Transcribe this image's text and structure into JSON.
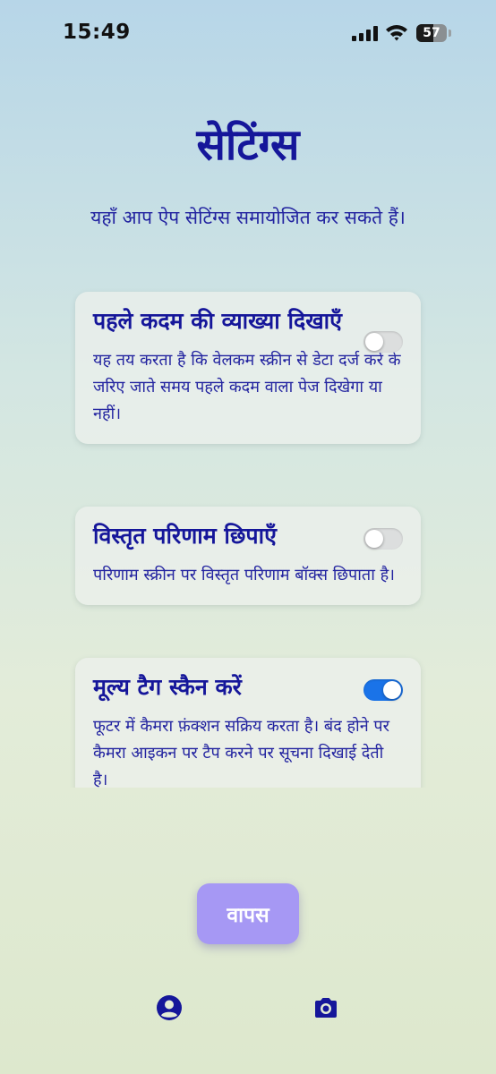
{
  "status_bar": {
    "time": "15:49",
    "battery_percent": 57,
    "battery_label": "57",
    "icons": [
      "cellular-signal-icon",
      "wifi-icon",
      "battery-icon"
    ]
  },
  "header": {
    "title": "सेटिंग्स",
    "subtitle": "यहाँ आप ऐप सेटिंग्स समायोजित कर सकते हैं।"
  },
  "settings": [
    {
      "title": "पहले कदम की व्याख्या दिखाएँ",
      "description": "यह तय करता है कि वेलकम स्क्रीन से डेटा दर्ज करें के जरिए जाते समय पहले कदम वाला पेज दिखेगा या नहीं।",
      "enabled": false
    },
    {
      "title": "विस्तृत परिणाम छिपाएँ",
      "description": "परिणाम स्क्रीन पर विस्तृत परिणाम बॉक्स छिपाता है।",
      "enabled": false
    },
    {
      "title": "मूल्य टैग स्कैन करें",
      "description": "फूटर में कैमरा फ़ंक्शन सक्रिय करता है। बंद होने पर कैमरा आइकन पर टैप करने पर सूचना दिखाई देती है।",
      "enabled": true
    }
  ],
  "actions": {
    "back_label": "वापस"
  },
  "footer": {
    "icons": [
      "profile-icon",
      "camera-icon"
    ]
  },
  "colors": {
    "primary_text": "#15169a",
    "toggle_on": "#1a73e8",
    "toggle_off": "#dcdede",
    "back_button": "#a698f4"
  }
}
